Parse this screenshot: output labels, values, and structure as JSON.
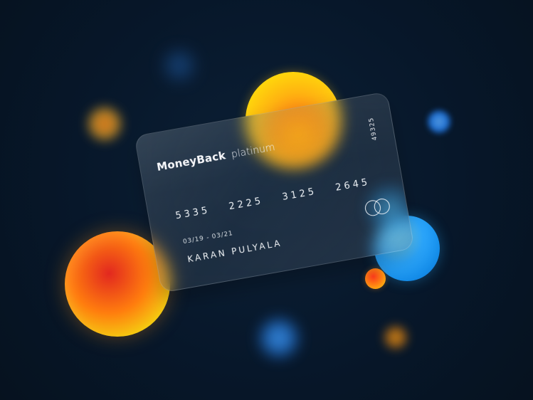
{
  "card": {
    "brand": "MoneyBack",
    "tier": "platinum",
    "side_number": "49325",
    "number_groups": [
      "5335",
      "2225",
      "3125",
      "2645"
    ],
    "validity": "03/19 - 03/21",
    "holder": "KARAN PULYALA"
  },
  "icons": {
    "network_logo": "interlocking-circles-icon"
  },
  "colors": {
    "background": "#07172a",
    "orange": "#ff8a12",
    "yellow": "#f4d211",
    "blue": "#2ba8ff"
  }
}
